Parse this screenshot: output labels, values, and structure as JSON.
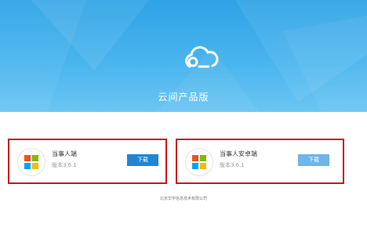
{
  "banner": {
    "title": "云间产品版",
    "logo_icon": "cloud-logo-icon",
    "colors": {
      "top": "#2ea3e6",
      "bottom": "#6cc6f3"
    }
  },
  "apps": [
    {
      "name": "当事人端",
      "version": "版本3.6.1",
      "button": "下载",
      "icon": "windows-icon",
      "highlighted": true
    },
    {
      "name": "当事人安卓端",
      "version": "版本3.6.1",
      "button": "下载",
      "icon": "windows-icon",
      "highlighted": true
    }
  ],
  "footer": {
    "text": "北京华宇信息技术有限公司"
  },
  "colors": {
    "highlight_border": "#c8161d",
    "button_primary": "#1f86d6",
    "button_light": "#6fb5e8"
  }
}
